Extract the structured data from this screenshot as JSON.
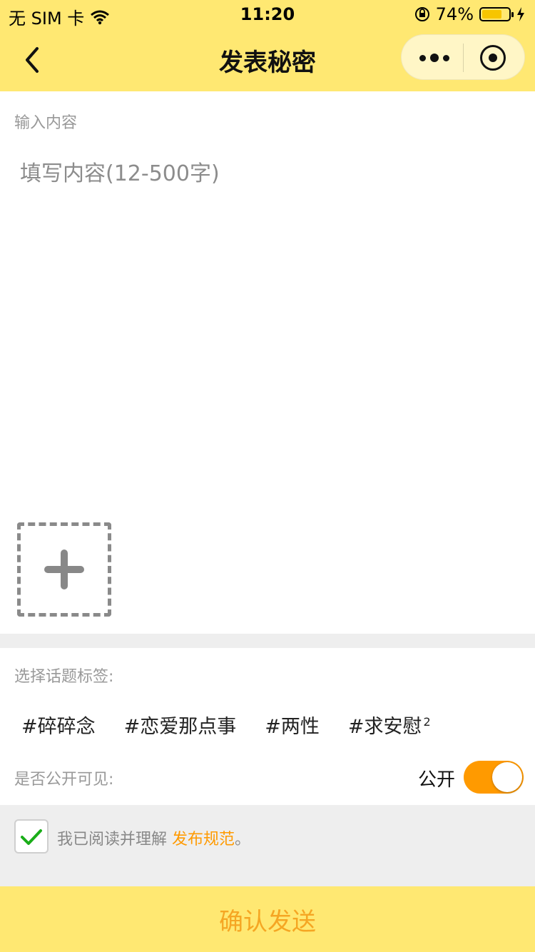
{
  "status_bar": {
    "carrier": "无 SIM 卡",
    "time": "11:20",
    "battery": "74%",
    "battery_level": 0.74
  },
  "nav": {
    "title": "发表秘密",
    "icons": {
      "back": "chevron-left-icon",
      "more": "more-dots-icon",
      "close": "target-circle-icon"
    }
  },
  "editor": {
    "label": "输入内容",
    "placeholder": "填写内容(12-500字)",
    "value": ""
  },
  "topics": {
    "label": "选择话题标签:",
    "tags": [
      {
        "text": "#碎碎念",
        "badge": ""
      },
      {
        "text": "#恋爱那点事",
        "badge": ""
      },
      {
        "text": "#两性",
        "badge": ""
      },
      {
        "text": "#求安慰",
        "badge": "2"
      }
    ]
  },
  "visibility": {
    "label": "是否公开可见:",
    "value_text": "公开",
    "enabled": true
  },
  "agreement": {
    "checked": true,
    "text": "我已阅读并理解 ",
    "link": "发布规范",
    "suffix": "。"
  },
  "submit": {
    "label": "确认发送"
  },
  "colors": {
    "header_bg": "#ffe872",
    "accent": "#ff9a00",
    "submit_text": "#f5a623",
    "check": "#1aad19"
  }
}
